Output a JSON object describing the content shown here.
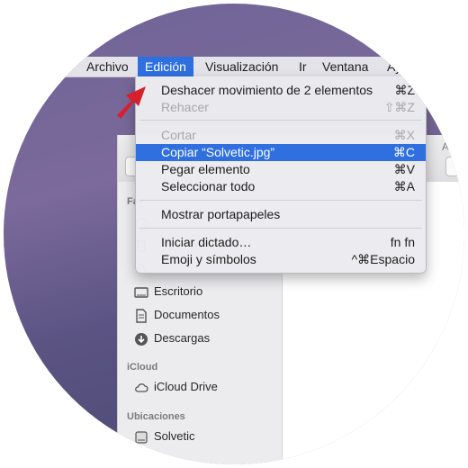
{
  "menubar": {
    "items": [
      "Archivo",
      "Edición",
      "Visualización",
      "Ir",
      "Ventana",
      "Ay"
    ],
    "active": "Edición"
  },
  "edit_menu": {
    "items": [
      {
        "label": "Deshacer movimiento de 2 elementos",
        "shortcut": "⌘Z",
        "state": "enabled"
      },
      {
        "label": "Rehacer",
        "shortcut": "⇧⌘Z",
        "state": "disabled"
      },
      {
        "label": "Cortar",
        "shortcut": "⌘X",
        "state": "disabled"
      },
      {
        "label": "Copiar “Solvetic.jpg”",
        "shortcut": "⌘C",
        "state": "highlighted"
      },
      {
        "label": "Pegar elemento",
        "shortcut": "⌘V",
        "state": "enabled"
      },
      {
        "label": "Seleccionar todo",
        "shortcut": "⌘A",
        "state": "enabled"
      },
      {
        "label": "Mostrar portapapeles",
        "shortcut": "",
        "state": "enabled"
      },
      {
        "label": "Iniciar dictado…",
        "shortcut": "fn fn",
        "state": "enabled"
      },
      {
        "label": "Emoji y símbolos",
        "shortcut": "^⌘Espacio",
        "state": "enabled"
      }
    ]
  },
  "finder": {
    "title_fragment": "Arc",
    "sidebar": {
      "favorites_header": "Fav",
      "items": [
        {
          "label": "Escritorio",
          "icon": "desktop-icon"
        },
        {
          "label": "Documentos",
          "icon": "document-icon"
        },
        {
          "label": "Descargas",
          "icon": "download-icon"
        }
      ],
      "icloud_header": "iCloud",
      "icloud_items": [
        {
          "label": "iCloud Drive",
          "icon": "cloud-icon"
        }
      ],
      "locations_header": "Ubicaciones",
      "location_items": [
        {
          "label": "Solvetic",
          "icon": "drive-icon"
        }
      ]
    }
  },
  "colors": {
    "accent": "#2f6fe0",
    "arrow": "#d5202e"
  }
}
